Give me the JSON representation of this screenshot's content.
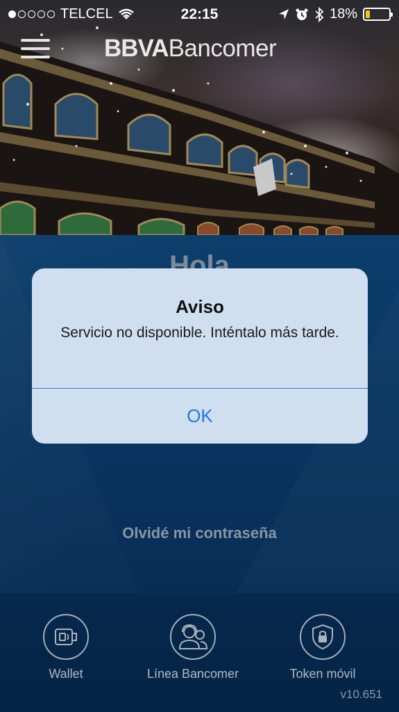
{
  "status_bar": {
    "carrier": "TELCEL",
    "time": "22:15",
    "battery": "18%",
    "battery_level": 0.18,
    "signal_bars_filled": 1,
    "signal_bars_total": 5,
    "icons": [
      "wifi-icon",
      "location-icon",
      "alarm-icon",
      "bluetooth-icon",
      "battery-icon"
    ]
  },
  "header": {
    "logo_bold": "BBVA",
    "logo_regular": "Bancomer",
    "menu_icon": "hamburger-menu-icon"
  },
  "main": {
    "greeting": "Hola",
    "forgot_password": "Olvidé mi contraseña"
  },
  "alert": {
    "title": "Aviso",
    "message": "Servicio no disponible. Inténtalo más tarde.",
    "ok_label": "OK"
  },
  "bottom_nav": {
    "items": [
      {
        "label": "Wallet",
        "icon": "wallet-card-icon"
      },
      {
        "label": "Línea Bancomer",
        "icon": "support-agents-icon"
      },
      {
        "label": "Token móvil",
        "icon": "shield-lock-icon"
      }
    ],
    "version": "v10.651"
  },
  "colors": {
    "main_blue": "#0a3d6e",
    "bottom_blue": "#072a50",
    "alert_bg": "#d0dff0",
    "ok_blue": "#1e7ae0",
    "battery_yellow": "#f5c518"
  }
}
